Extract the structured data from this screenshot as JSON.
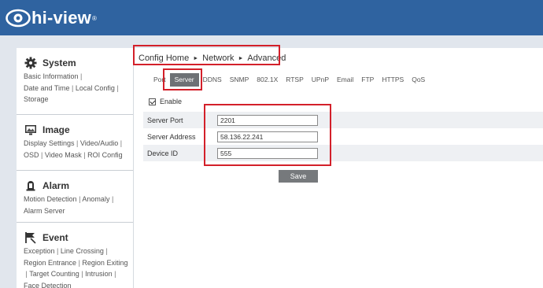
{
  "header": {
    "brand": "hi-view",
    "brand_mark": "®",
    "background_color": "#2f63a0"
  },
  "sidebar": {
    "sections": [
      {
        "title": "System",
        "icon": "gear-icon",
        "links": [
          "Basic Information",
          "Date and Time",
          "Local Config",
          "Storage"
        ]
      },
      {
        "title": "Image",
        "icon": "monitor-icon",
        "links": [
          "Display Settings",
          "Video/Audio",
          "OSD",
          "Video Mask",
          "ROI Config"
        ]
      },
      {
        "title": "Alarm",
        "icon": "bell-icon",
        "links": [
          "Motion Detection",
          "Anomaly",
          "Alarm Server"
        ]
      },
      {
        "title": "Event",
        "icon": "event-icon",
        "links": [
          "Exception",
          "Line Crossing",
          "Region Entrance",
          "Region Exiting",
          "Target Counting",
          "Intrusion",
          "Face Detection"
        ]
      }
    ]
  },
  "breadcrumb": {
    "items": [
      "Config Home",
      "Network",
      "Advanced"
    ],
    "separator": "►"
  },
  "tabs": {
    "items": [
      "Port",
      "Server",
      "DDNS",
      "SNMP",
      "802.1X",
      "RTSP",
      "UPnP",
      "Email",
      "FTP",
      "HTTPS",
      "QoS"
    ],
    "active": "Server"
  },
  "form": {
    "enable_label": "Enable",
    "enable_checked": true,
    "fields": [
      {
        "label": "Server Port",
        "value": "2201"
      },
      {
        "label": "Server Address",
        "value": "58.136.22.241"
      },
      {
        "label": "Device ID",
        "value": "555"
      }
    ],
    "save_label": "Save"
  },
  "highlight_color": "#d3202a"
}
